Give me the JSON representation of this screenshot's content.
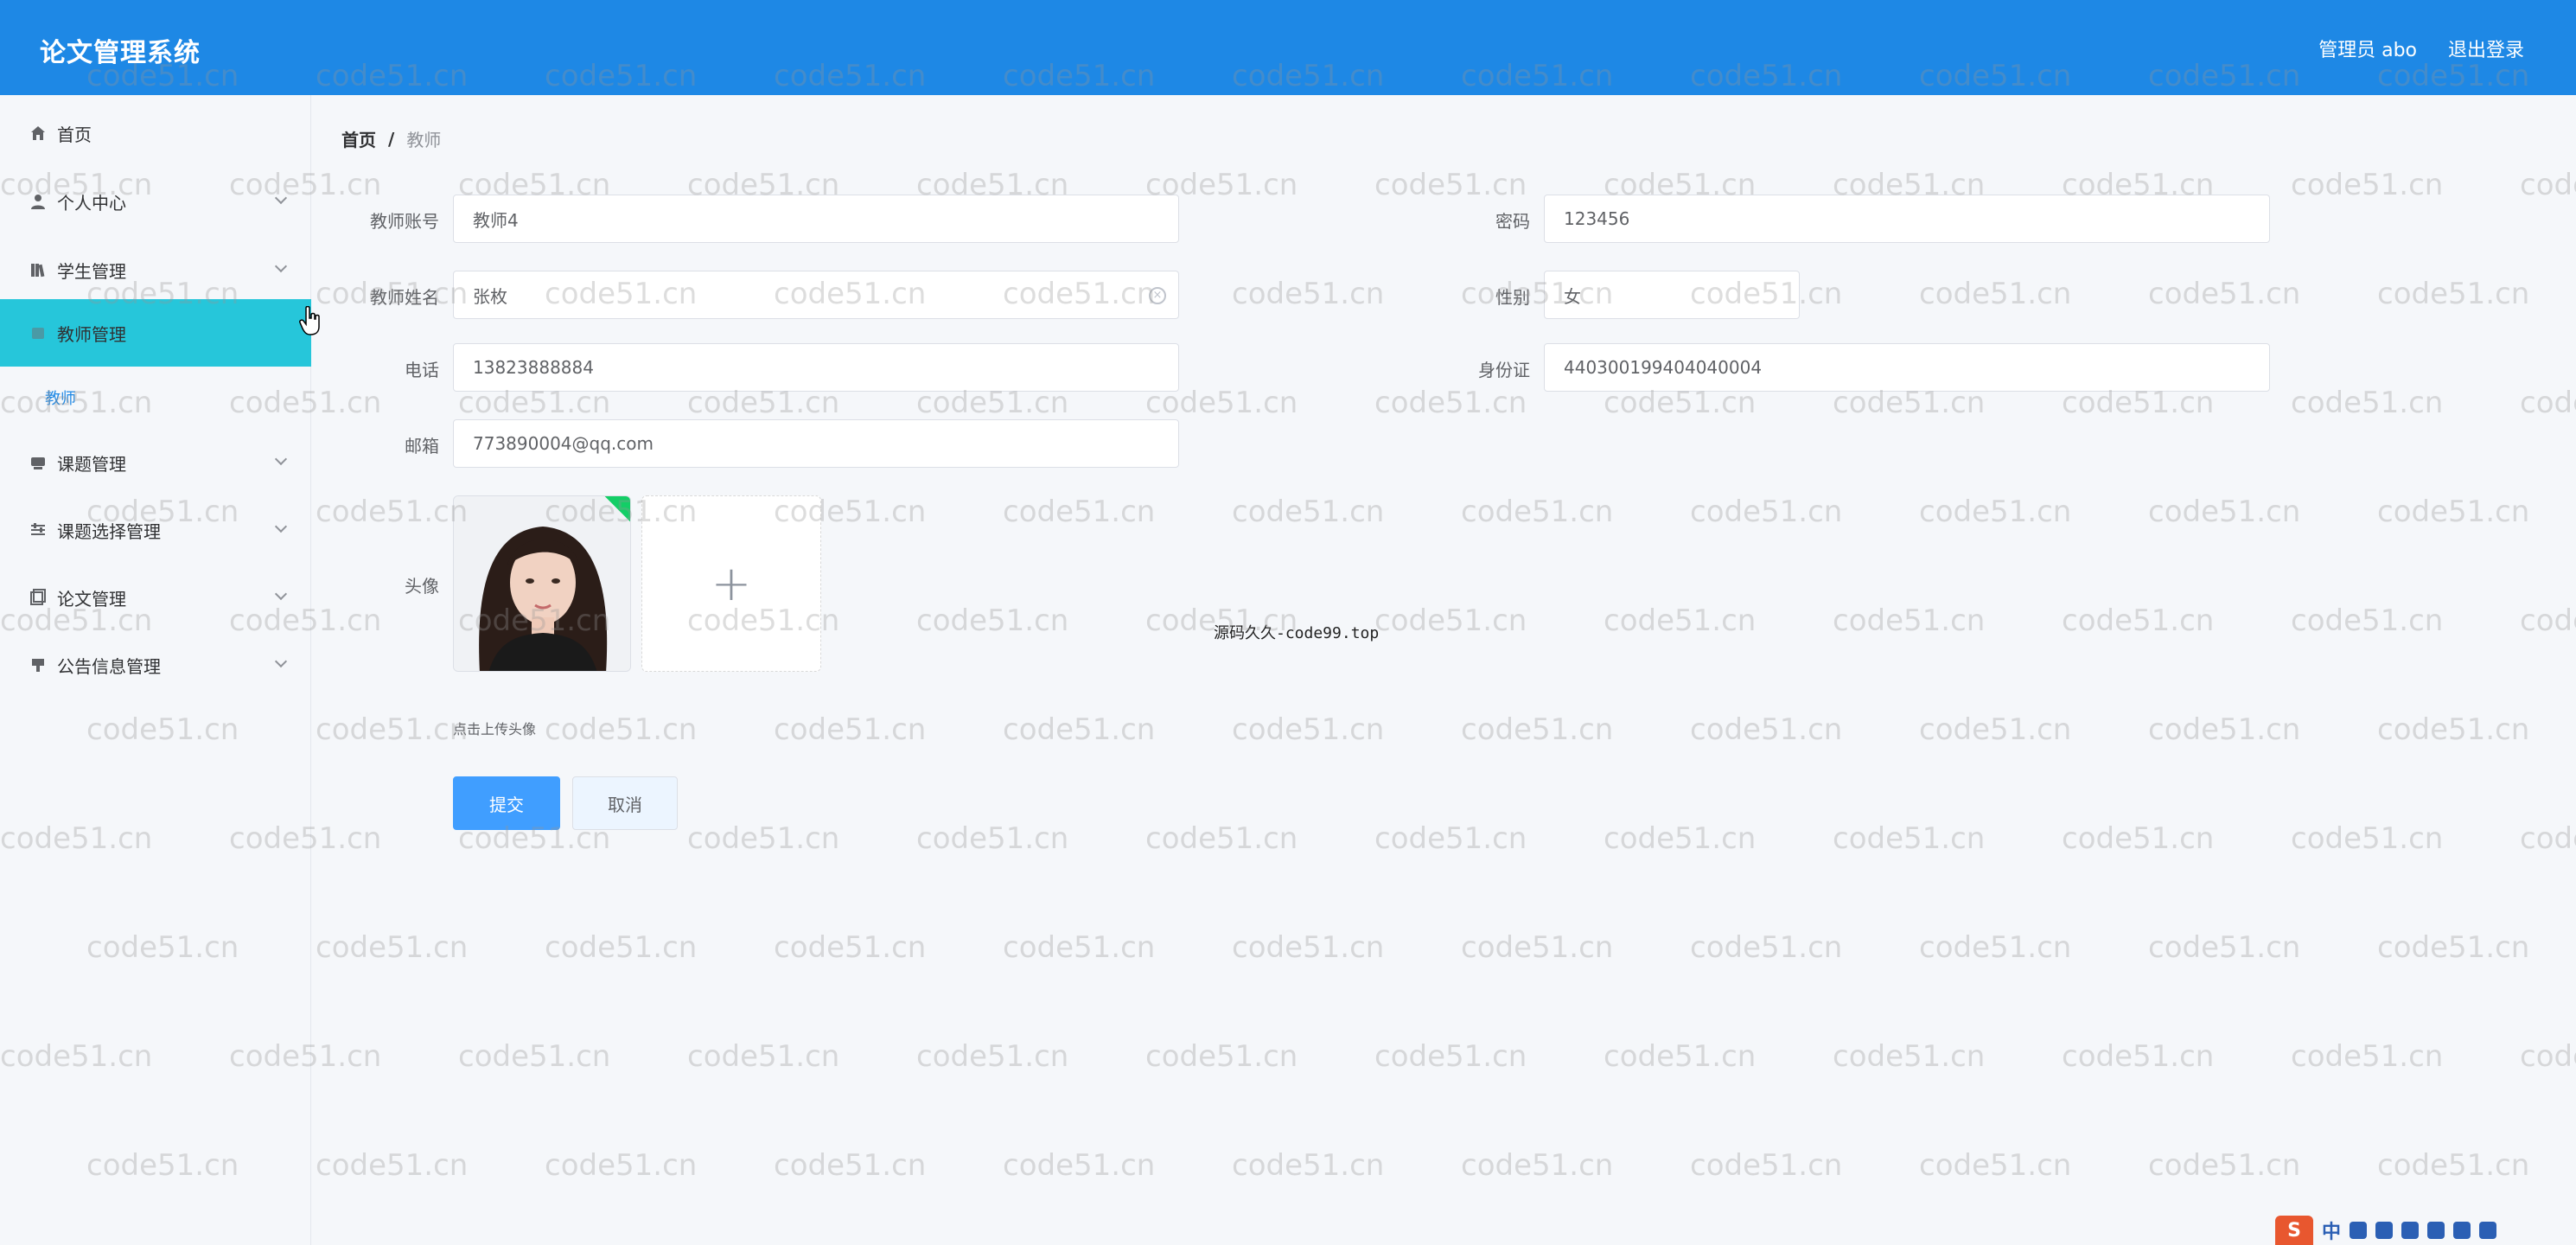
{
  "app": {
    "title": "论文管理系统"
  },
  "header": {
    "user": "管理员 abo",
    "logout": "退出登录"
  },
  "sidebar": {
    "items": [
      {
        "label": "首页",
        "icon": "home-icon"
      },
      {
        "label": "个人中心",
        "icon": "user-icon"
      },
      {
        "label": "学生管理",
        "icon": "books-icon"
      },
      {
        "label": "教师管理",
        "icon": "teacher-icon",
        "active": true
      },
      {
        "label": "课题管理",
        "icon": "topic-icon"
      },
      {
        "label": "课题选择管理",
        "icon": "sliders-icon"
      },
      {
        "label": "论文管理",
        "icon": "paper-icon"
      },
      {
        "label": "公告信息管理",
        "icon": "notice-icon"
      }
    ],
    "sub_item": "教师"
  },
  "breadcrumb": {
    "home": "首页",
    "separator": "/",
    "current": "教师"
  },
  "form": {
    "account": {
      "label": "教师账号",
      "value": "教师4"
    },
    "password": {
      "label": "密码",
      "value": "123456"
    },
    "name": {
      "label": "教师姓名",
      "value": "张枚"
    },
    "gender": {
      "label": "性别",
      "value": "女"
    },
    "phone": {
      "label": "电话",
      "value": "13823888884"
    },
    "id_card": {
      "label": "身份证",
      "value": "440300199404040004"
    },
    "email": {
      "label": "邮箱",
      "value": "773890004@qq.com"
    },
    "avatar": {
      "label": "头像",
      "tip": "点击上传头像"
    },
    "submit": "提交",
    "cancel": "取消"
  },
  "overlay": {
    "source_tag": "源码久久-code99.top",
    "watermark": "code51.cn"
  },
  "ime": {
    "logo": "S",
    "lang": "中"
  },
  "colors": {
    "header": "#1e88e5",
    "active_menu": "#26c6da",
    "primary": "#409eff",
    "success": "#13ce66"
  }
}
